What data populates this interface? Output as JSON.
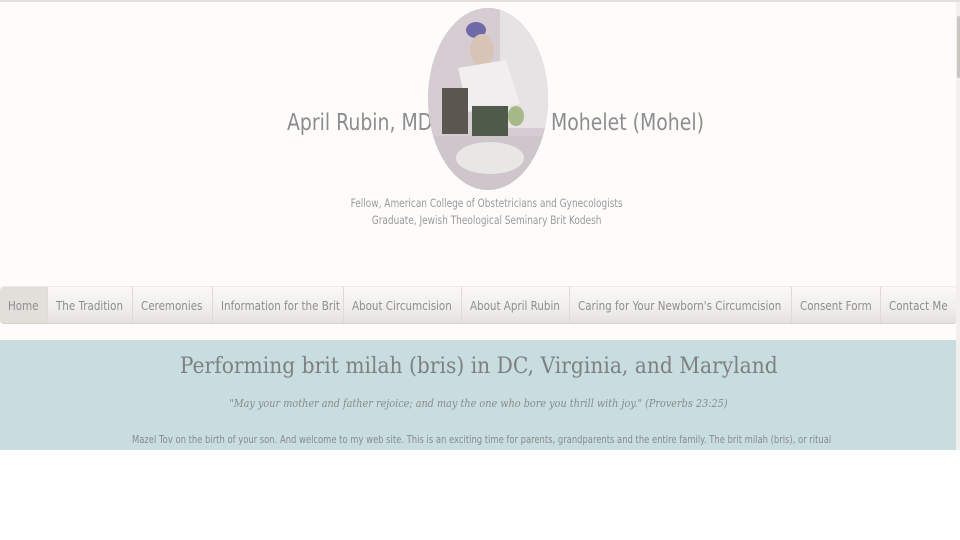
{
  "header": {
    "name": "April Rubin, MD",
    "title": "Mohelet (Mohel)",
    "credentials": [
      "Fellow, American College of Obstetricians and Gynecologists",
      "Graduate, Jewish Theological Seminary Brit Kodesh"
    ]
  },
  "nav": {
    "items": [
      {
        "label": "Home",
        "active": true
      },
      {
        "label": "The Tradition"
      },
      {
        "label": "Ceremonies"
      },
      {
        "label": "Information for the Brit"
      },
      {
        "label": "About Circumcision"
      },
      {
        "label": "About April Rubin"
      },
      {
        "label": "Caring for Your Newborn's Circumcision"
      },
      {
        "label": "Consent Form"
      },
      {
        "label": "Contact Me"
      }
    ]
  },
  "main": {
    "title": "Performing brit milah (bris) in DC, Virginia, and Maryland",
    "quote": "\"May your mother and father rejoice; and may the one who bore you thrill with joy.\" (Proverbs 23:25)",
    "intro": "Mazel Tov on the birth of your son.  And welcome to my web site.  This is an exciting time for parents, grandparents and the entire family.  The brit milah (bris), or ritual"
  },
  "colors": {
    "content_background": "#c7dde0",
    "nav_active": "#e2dfdb",
    "text_gray": "#8d8d8d"
  }
}
